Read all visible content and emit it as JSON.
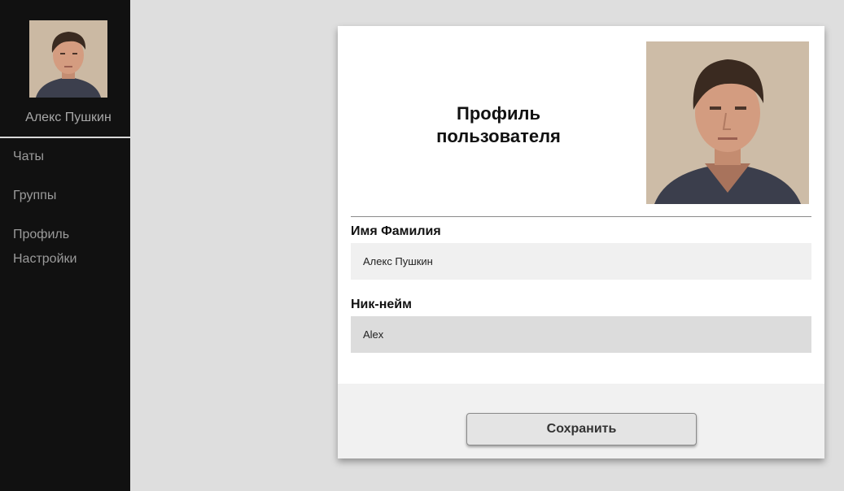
{
  "sidebar": {
    "user_name": "Алекс Пушкин",
    "items": [
      {
        "label": "Чаты"
      },
      {
        "label": "Группы"
      },
      {
        "label": "Профиль"
      },
      {
        "label": "Настройки"
      }
    ]
  },
  "profile": {
    "title": "Профиль пользователя",
    "full_name_label": "Имя Фамилия",
    "full_name_value": "Алекс Пушкин",
    "nickname_label": "Ник-нейм",
    "nickname_value": "Alex",
    "save_label": "Сохранить"
  },
  "colors": {
    "sidebar_bg": "#111111",
    "page_bg": "#dedede",
    "card_bg": "#ffffff"
  }
}
